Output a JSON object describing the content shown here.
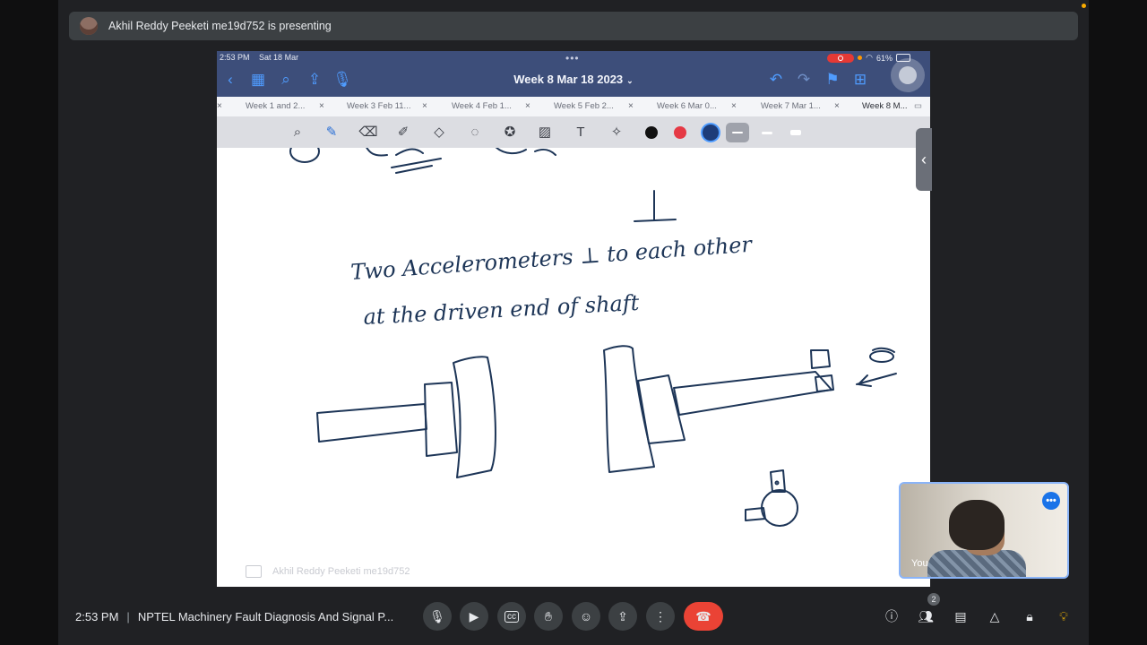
{
  "banner": {
    "presenting_text": "Akhil Reddy Peeketi me19d752 is presenting"
  },
  "ipad": {
    "status_time": "2:53 PM",
    "status_date": "Sat 18 Mar",
    "battery": "61%",
    "doc_title": "Week 8 Mar 18 2023",
    "tabs": [
      {
        "label": "Week 1 and 2..."
      },
      {
        "label": "Week 3 Feb 11..."
      },
      {
        "label": "Week 4 Feb 1..."
      },
      {
        "label": "Week 5 Feb 2..."
      },
      {
        "label": "Week 6 Mar 0..."
      },
      {
        "label": "Week 7 Mar 1..."
      },
      {
        "label": "Week 8 M..."
      }
    ],
    "toolbar_colors": {
      "black": "#111111",
      "red": "#e53945",
      "navy": "#1d3c78"
    },
    "ink_color": "#1d3557",
    "note_line1": "Two  Accelerometers   ⊥   to  each  other",
    "note_line2": "at  the  driven  end  of  shaft",
    "watermark_name": "Akhil Reddy Peeketi me19d752"
  },
  "self_view": {
    "label": "You"
  },
  "bottom": {
    "time": "2:53 PM",
    "meeting_title": "NPTEL Machinery Fault Diagnosis And Signal P...",
    "participants_count": "2"
  },
  "colors": {
    "end_call": "#ea4335",
    "accent": "#8ab4f8"
  }
}
